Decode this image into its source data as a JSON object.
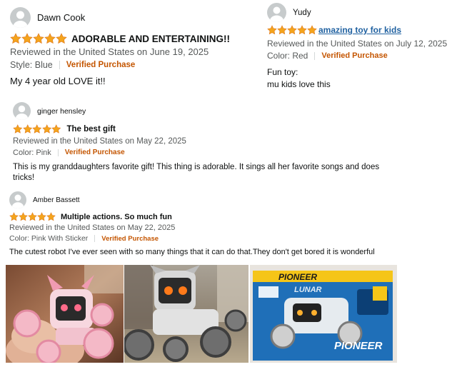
{
  "reviews": [
    {
      "name": "Dawn Cook",
      "rating": 5,
      "title": "ADORABLE AND ENTERTAINING!!",
      "date": "Reviewed in the United States on June 19, 2025",
      "variant": "Style: Blue",
      "verified": "Verified Purchase",
      "body": [
        "My 4 year old LOVE it!!"
      ]
    },
    {
      "name": "Yudy",
      "rating": 5,
      "title": " amazing toy for kids",
      "date": "Reviewed in the United States on July 12, 2025",
      "variant": "Color: Red",
      "verified": "Verified Purchase",
      "body": [
        "Fun toy:",
        "mu kids love this"
      ]
    },
    {
      "name": "ginger hensley",
      "rating": 5,
      "title": "The best gift",
      "date": "Reviewed in the United States on May 22, 2025",
      "variant": "Color: Pink",
      "verified": "Verified Purchase",
      "body": [
        "This is my granddaughters favorite gift! This thing is adorable. It sings all her favorite songs and does",
        "tricks!"
      ]
    },
    {
      "name": "Amber Bassett",
      "rating": 5,
      "title": "Multiple actions. So much fun",
      "date": "Reviewed in the United States on May 22, 2025",
      "variant": "Color: Pink With Sticker",
      "verified": "Verified Purchase",
      "body": [
        "The cutest robot I've ever seen with so many things that it can do that.They don't get bored it is wonderful"
      ]
    }
  ],
  "photos": [
    {
      "name": "pink robot dog held in hand"
    },
    {
      "name": "gray robot dog on carpet"
    },
    {
      "name": "Lunar Pioneer toy in box",
      "box_text_top": "PIONEER",
      "box_brand_1": "LUNAR",
      "box_brand_2": "PIONEER"
    }
  ],
  "colors": {
    "star": "#f4a41c",
    "verified": "#c45500",
    "link": "#2162a1",
    "meta": "#565959"
  }
}
